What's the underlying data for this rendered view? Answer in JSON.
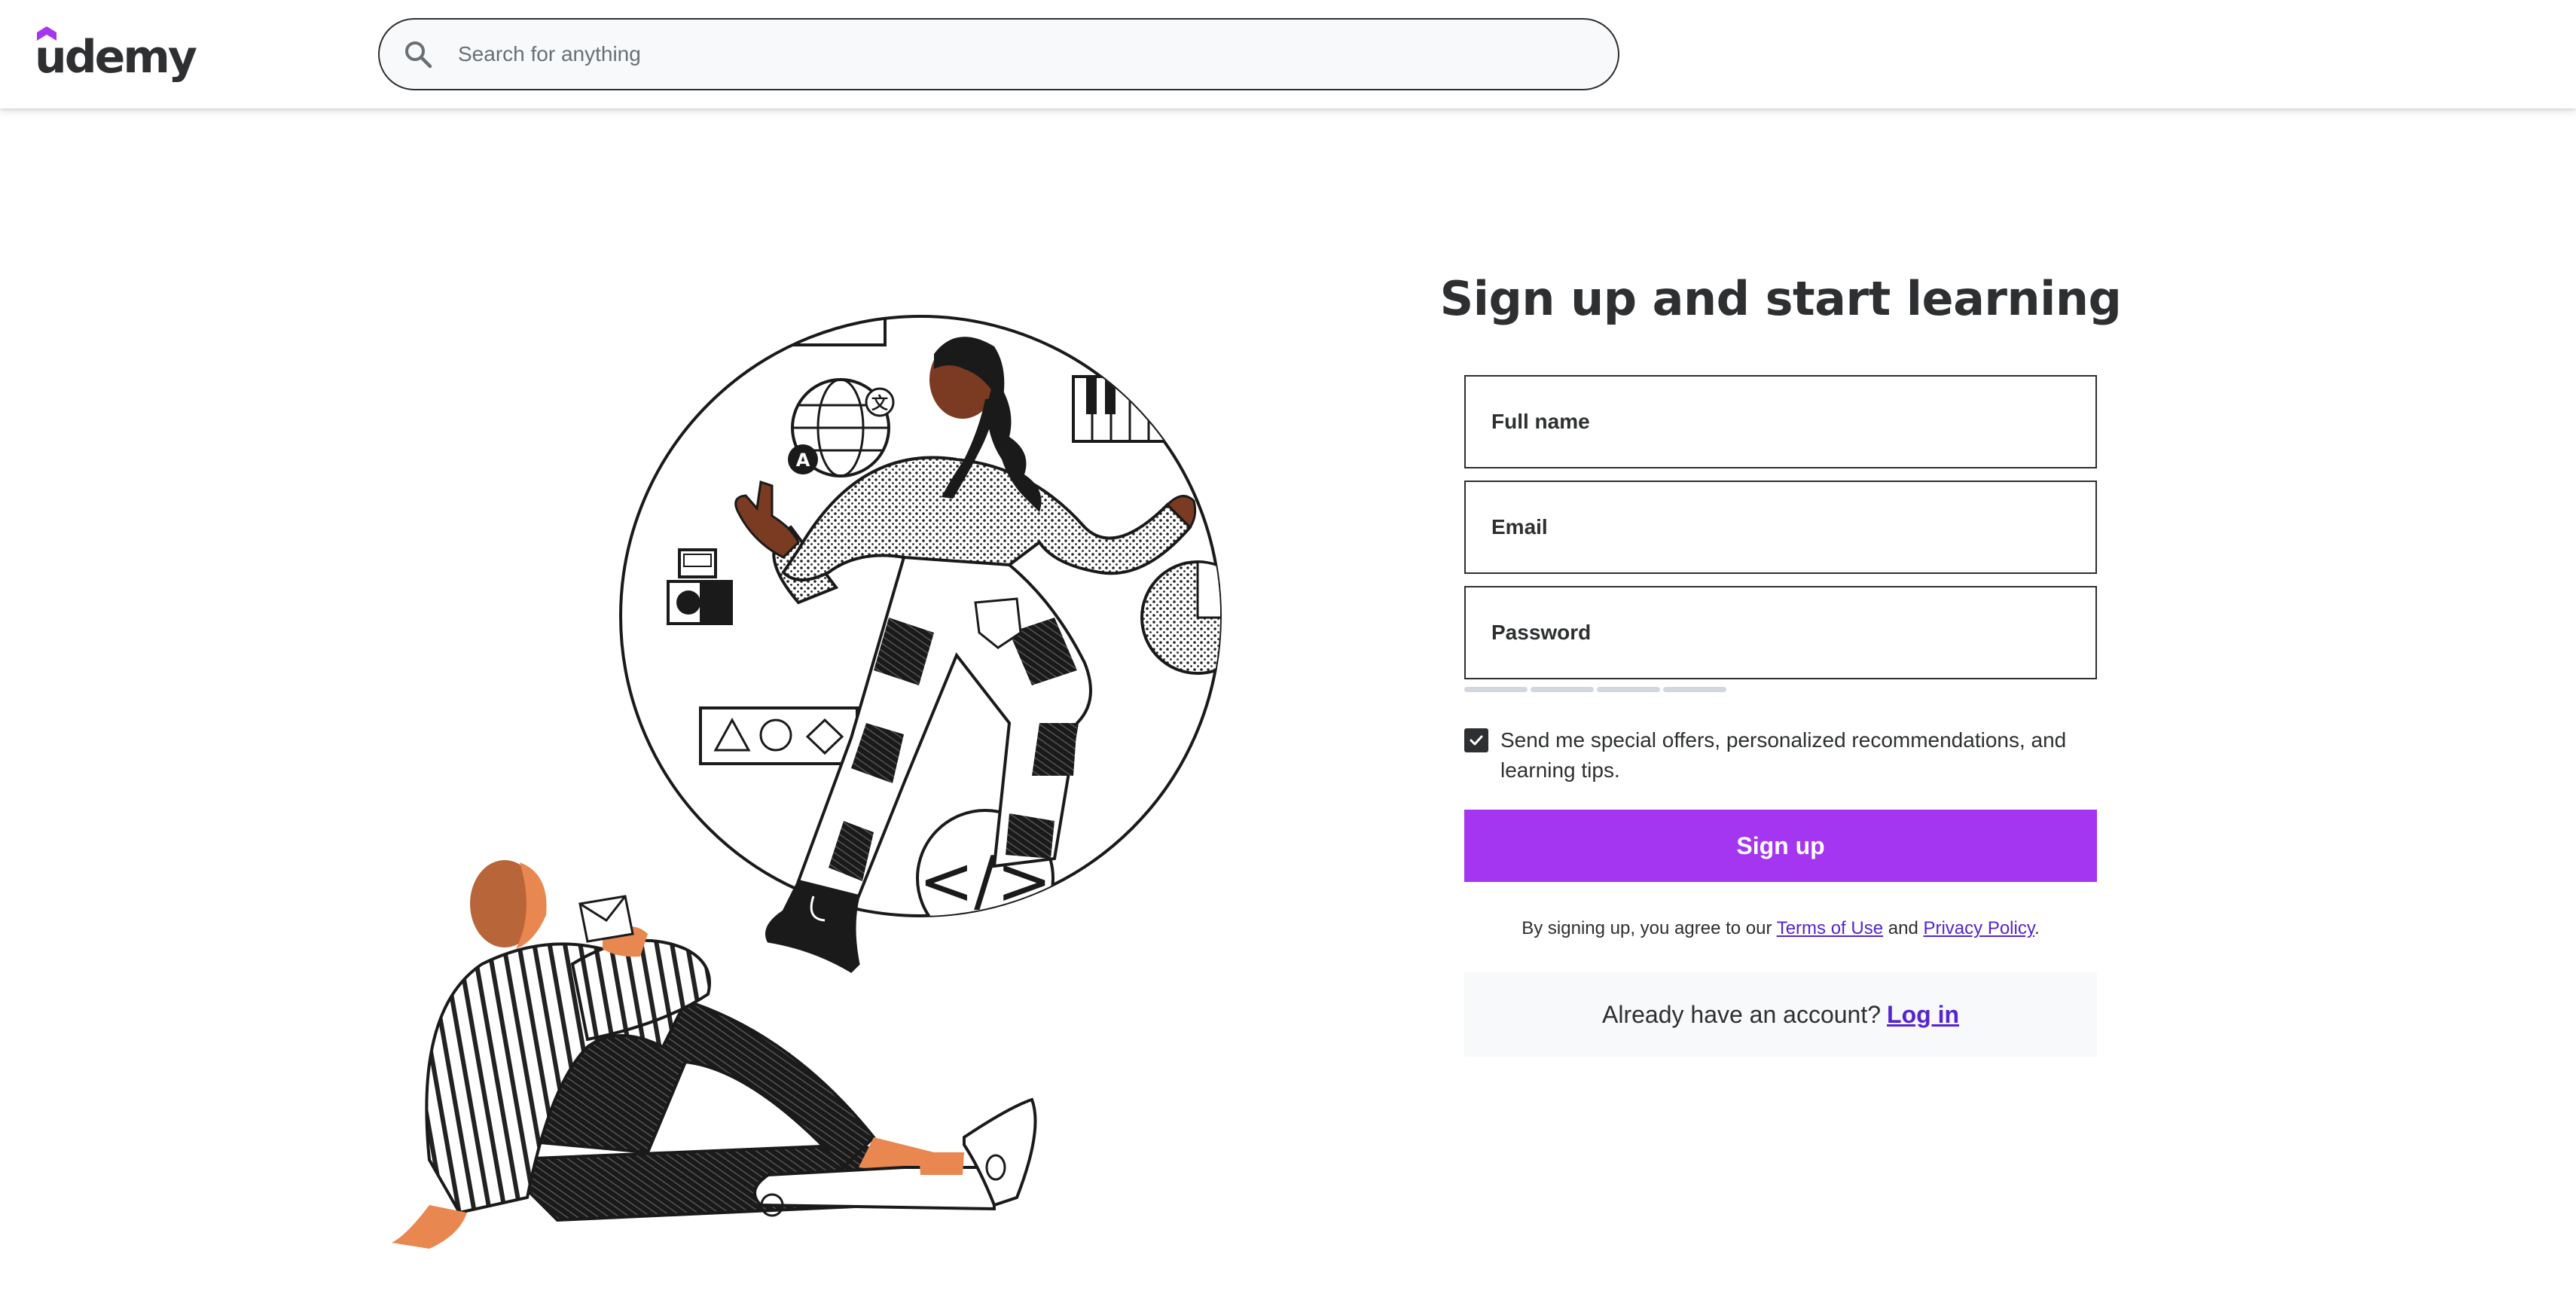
{
  "header": {
    "logo_text": "udemy",
    "logo_icon": "udemy-hat-logo",
    "search": {
      "placeholder": "Search for anything",
      "icon": "search-icon"
    }
  },
  "form": {
    "title": "Sign up and start learning",
    "fields": {
      "full_name": {
        "placeholder": "Full name"
      },
      "email": {
        "placeholder": "Email"
      },
      "password": {
        "placeholder": "Password"
      }
    },
    "password_strength": {
      "segments": 4,
      "filled": 0
    },
    "offers_checkbox": {
      "checked": true,
      "label": "Send me special offers, personalized recommendations, and learning tips."
    },
    "submit_label": "Sign up",
    "legal": {
      "prefix": "By signing up, you agree to our",
      "terms": "Terms of Use",
      "and": "and",
      "privacy": "Privacy Policy",
      "suffix": "."
    },
    "login": {
      "prompt": "Already have an account?",
      "link": "Log in"
    }
  },
  "colors": {
    "brand_purple": "#a435f0",
    "link_purple": "#5624d0",
    "text_dark": "#2d2f31",
    "skin_dark": "#7a3b22",
    "skin_light": "#e8874f"
  }
}
